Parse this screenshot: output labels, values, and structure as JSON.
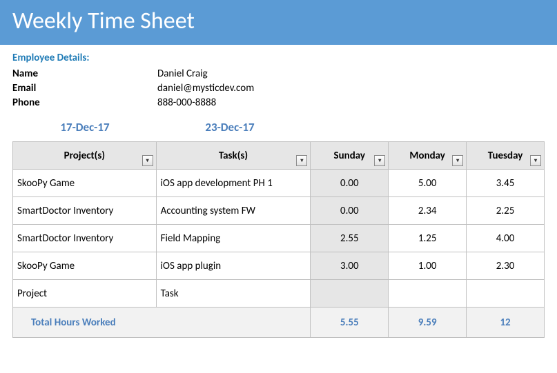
{
  "header": {
    "title": "Weekly Time Sheet"
  },
  "employee": {
    "section_title": "Employee Details:",
    "labels": {
      "name": "Name",
      "email": "Email",
      "phone": "Phone"
    },
    "values": {
      "name": "Daniel Craig",
      "email": "daniel@mysticdev.com",
      "phone": "888-000-8888"
    }
  },
  "dates": {
    "start": "17-Dec-17",
    "end": "23-Dec-17"
  },
  "table": {
    "columns": {
      "project": "Project(s)",
      "task": "Task(s)",
      "sunday": "Sunday",
      "monday": "Monday",
      "tuesday": "Tuesday"
    },
    "rows": [
      {
        "project": "SkooPy Game",
        "task": "iOS app development PH 1",
        "sunday": "0.00",
        "monday": "5.00",
        "tuesday": "3.45"
      },
      {
        "project": "SmartDoctor Inventory",
        "task": "Accounting system FW",
        "sunday": "0.00",
        "monday": "2.34",
        "tuesday": "2.25"
      },
      {
        "project": "SmartDoctor Inventory",
        "task": "Field Mapping",
        "sunday": "2.55",
        "monday": "1.25",
        "tuesday": "4.00"
      },
      {
        "project": "SkooPy Game",
        "task": "iOS app plugin",
        "sunday": "3.00",
        "monday": "1.00",
        "tuesday": "2.30"
      },
      {
        "project": "Project",
        "task": "Task",
        "sunday": "",
        "monday": "",
        "tuesday": ""
      }
    ],
    "totals": {
      "label": "Total Hours Worked",
      "sunday": "5.55",
      "monday": "9.59",
      "tuesday": "12"
    }
  },
  "icons": {
    "dropdown": "▾"
  }
}
